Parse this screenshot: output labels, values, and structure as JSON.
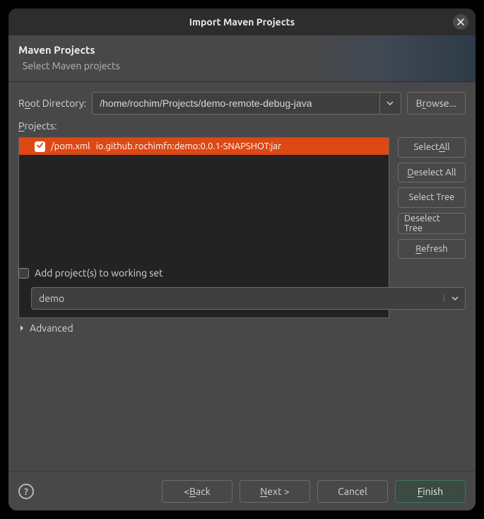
{
  "title": "Import Maven Projects",
  "header": {
    "title": "Maven Projects",
    "subtitle": "Select Maven projects"
  },
  "root_dir": {
    "label_pre": "R",
    "label_u": "o",
    "label_post": "ot Directory:",
    "value": "/home/rochim/Projects/demo-remote-debug-java",
    "browse_pre": "B",
    "browse_u": "r",
    "browse_post": "owse..."
  },
  "projects": {
    "label_pre": "P",
    "label_u": "r",
    "label_post": "ojects:",
    "items": [
      {
        "path": "/pom.xml",
        "artifact": "io.github.rochimfn:demo:0.0.1-SNAPSHOT:jar",
        "checked": true
      }
    ]
  },
  "side": {
    "select_all_pre": "Select ",
    "select_all_u": "A",
    "select_all_post": "ll",
    "deselect_all_pre": "",
    "deselect_all_u": "D",
    "deselect_all_post": "eselect All",
    "select_tree": "Select Tree",
    "deselect_tree": "Deselect Tree",
    "refresh_pre": "",
    "refresh_u": "R",
    "refresh_post": "efresh"
  },
  "workingset": {
    "checkbox_label": "Add project(s) to working set",
    "value": "demo"
  },
  "advanced": {
    "label": "Advanced"
  },
  "footer": {
    "back_pre": "< ",
    "back_u": "B",
    "back_post": "ack",
    "next_pre": "",
    "next_u": "N",
    "next_post": "ext >",
    "cancel": "Cancel",
    "finish_pre": "",
    "finish_u": "F",
    "finish_post": "inish"
  }
}
